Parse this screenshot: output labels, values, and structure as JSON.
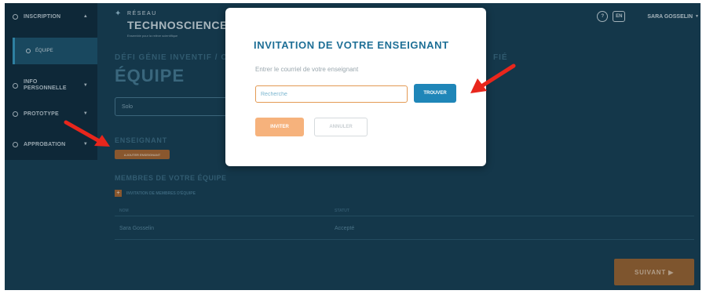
{
  "sidebar": {
    "items": [
      {
        "label": "INSCRIPTION"
      },
      {
        "label": "INFO PERSONNELLE"
      },
      {
        "label": "PROTOTYPE"
      },
      {
        "label": "APPROBATION"
      }
    ],
    "sub_item": {
      "label": "ÉQUIPE"
    }
  },
  "logo": {
    "line1": "RÉSEAU",
    "line2": "TECHNOSCIENCE",
    "tagline": "Ensemble pour la relève scientifique"
  },
  "header": {
    "help_label": "?",
    "lang_label": "EN",
    "user_name": "SARA GOSSELIN"
  },
  "page": {
    "crumb": "DÉFI GÉNIE INVENTIF / C",
    "crumb_tail": "FIÉ",
    "title": "ÉQUIPE",
    "team_type": "Solo",
    "teacher_section": "ENSEIGNANT",
    "add_teacher_label": "AJOUTER ENSEIGNANT",
    "members_section": "MEMBRES DE VOTRE ÉQUIPE",
    "invite_members_label": "INVITATION DE MEMBRES D'ÉQUIPE",
    "invite_members_icon": "plus-icon",
    "table": {
      "headers": [
        "NOM",
        "STATUT"
      ],
      "rows": [
        {
          "name": "Sara Gosselin",
          "status": "Accepté"
        }
      ]
    },
    "next_label": "SUIVANT ▶"
  },
  "modal": {
    "title": "INVITATION DE VOTRE ENSEIGNANT",
    "description": "Entrer le courriel de votre enseignant",
    "search_placeholder": "Recherche",
    "search_value": "",
    "find_label": "TROUVER",
    "invite_label": "INVITER",
    "cancel_label": "ANNULER"
  },
  "colors": {
    "background": "#173f55",
    "accent_blue": "#1f86b8",
    "accent_orange": "#f6b27c",
    "annotation_red": "#e8261c"
  }
}
